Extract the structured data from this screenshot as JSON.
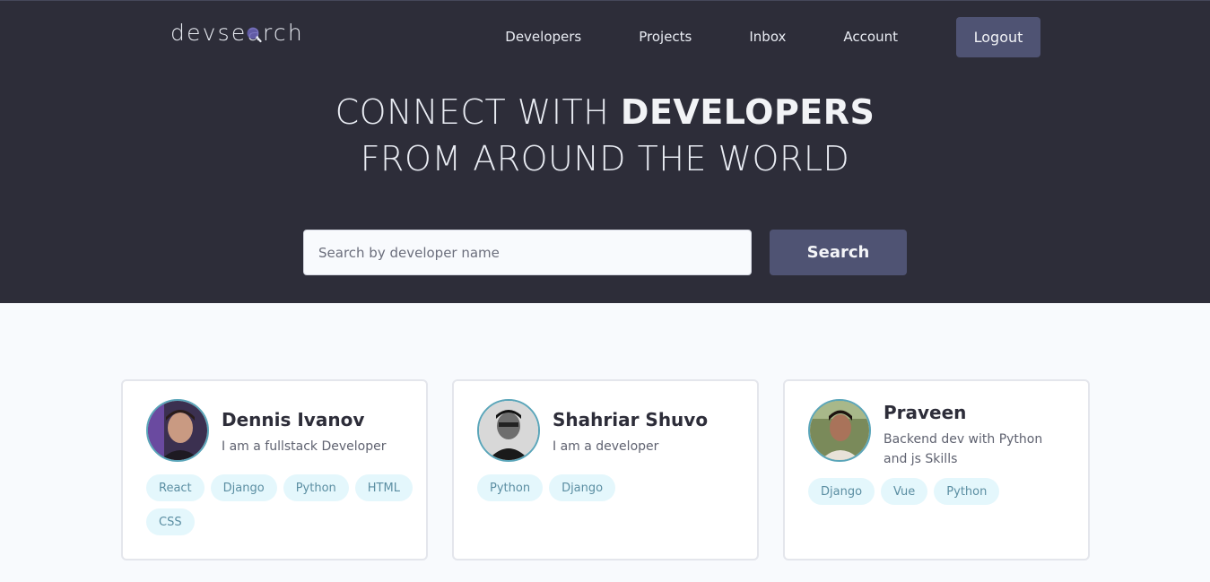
{
  "logo": {
    "text_before": "devse",
    "text_lens": "a",
    "text_after": "rch"
  },
  "nav": {
    "items": [
      {
        "label": "Developers"
      },
      {
        "label": "Projects"
      },
      {
        "label": "Inbox"
      },
      {
        "label": "Account"
      }
    ],
    "logout_label": "Logout"
  },
  "hero": {
    "line1_prefix": "CONNECT WITH ",
    "line1_bold": "DEVELOPERS",
    "line2": "FROM AROUND THE WORLD"
  },
  "search": {
    "placeholder": "Search by developer name",
    "value": "",
    "button_label": "Search"
  },
  "developers": [
    {
      "name": "Dennis Ivanov",
      "bio": "I am a fullstack Developer",
      "tags": [
        "React",
        "Django",
        "Python",
        "HTML",
        "CSS"
      ]
    },
    {
      "name": "Shahriar Shuvo",
      "bio": "I am a developer",
      "tags": [
        "Python",
        "Django"
      ]
    },
    {
      "name": "Praveen",
      "bio": "Backend dev with Python and js Skills",
      "tags": [
        "Django",
        "Vue",
        "Python"
      ]
    }
  ],
  "colors": {
    "header_bg": "#2d2d39",
    "accent_button": "#4f5373",
    "page_bg": "#f8fafd",
    "tag_bg": "#e4f7fc",
    "tag_text": "#5b8ea2",
    "avatar_border": "#5aa5b9"
  }
}
